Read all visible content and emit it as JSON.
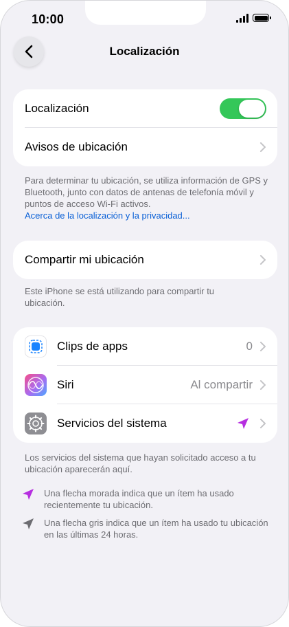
{
  "status_bar": {
    "time": "10:00"
  },
  "nav": {
    "title": "Localización"
  },
  "section1": {
    "location_label": "Localización",
    "location_enabled": true,
    "alerts_label": "Avisos de ubicación"
  },
  "section1_footer": {
    "text": "Para determinar tu ubicación, se utiliza información de GPS y Bluetooth, junto con datos de antenas de telefonía móvil y puntos de acceso Wi-Fi activos.",
    "link": "Acerca de la localización y la privacidad..."
  },
  "section2": {
    "share_label": "Compartir mi ubicación"
  },
  "section2_footer": {
    "text": "Este iPhone se está utilizando para compartir tu ubicación."
  },
  "section3": {
    "items": [
      {
        "label": "Clips de apps",
        "value": "0",
        "icon": "app-clips-icon"
      },
      {
        "label": "Siri",
        "value": "Al compartir",
        "icon": "siri-icon"
      },
      {
        "label": "Servicios del sistema",
        "value": "",
        "icon": "settings-gear-icon"
      }
    ]
  },
  "section3_footer": {
    "text": "Los servicios del sistema que hayan solicitado acceso a tu ubicación aparecerán aquí.",
    "legend_purple": "Una flecha morada indica que un ítem ha usado recientemente tu ubicación.",
    "legend_gray": "Una flecha gris indica que un ítem ha usado tu ubicación en las últimas 24 horas."
  },
  "colors": {
    "toggle_on": "#34c759",
    "link": "#0a60d6",
    "arrow_purple": "#b62fe0",
    "arrow_gray": "#6d6d72",
    "background": "#f2f1f6"
  }
}
